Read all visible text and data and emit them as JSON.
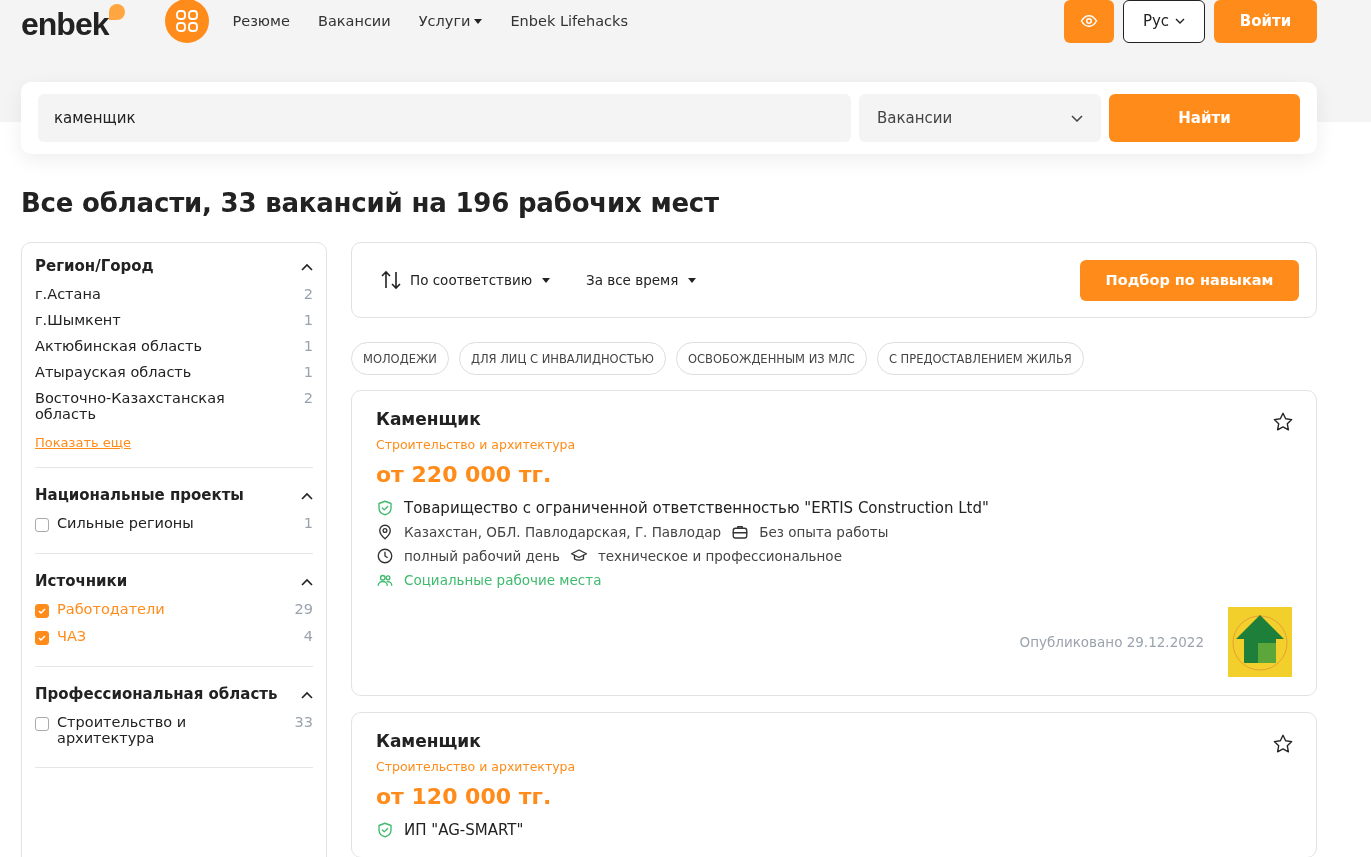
{
  "header": {
    "logo": "enbek",
    "nav": [
      {
        "label": "Резюме",
        "dropdown": false
      },
      {
        "label": "Вакансии",
        "dropdown": false
      },
      {
        "label": "Услуги",
        "dropdown": true
      },
      {
        "label": "Enbek Lifehacks",
        "dropdown": false
      }
    ],
    "language": "Рус",
    "login": "Войти"
  },
  "search": {
    "value": "каменщик",
    "type": "Вакансии",
    "button": "Найти"
  },
  "heading": "Все области, 33 вакансий на 196 рабочих мест",
  "filters": [
    {
      "title": "Регион/Город",
      "expanded": true,
      "items": [
        {
          "kind": "plain",
          "label": "г.Астана",
          "count": "2"
        },
        {
          "kind": "plain",
          "label": "г.Шымкент",
          "count": "1"
        },
        {
          "kind": "plain",
          "label": "Актюбинская область",
          "count": "1"
        },
        {
          "kind": "plain",
          "label": "Атырауская область",
          "count": "1"
        },
        {
          "kind": "plain",
          "label": "Восточно-Казахстанская область",
          "count": "2"
        }
      ],
      "more": "Показать еще"
    },
    {
      "title": "Национальные проекты",
      "expanded": true,
      "items": [
        {
          "kind": "checkbox",
          "label": "Сильные регионы",
          "count": "1",
          "checked": false
        }
      ]
    },
    {
      "title": "Источники",
      "expanded": true,
      "items": [
        {
          "kind": "checkbox",
          "label": "Работодатели",
          "count": "29",
          "checked": true
        },
        {
          "kind": "checkbox",
          "label": "ЧАЗ",
          "count": "4",
          "checked": true
        }
      ]
    },
    {
      "title": "Профессиональная область",
      "expanded": true,
      "items": [
        {
          "kind": "checkbox",
          "label": "Строительство и архитектура",
          "count": "33",
          "checked": false
        }
      ]
    }
  ],
  "toolbar": {
    "sort": "По соответствию",
    "period": "За все время",
    "skills_button": "Подбор по навыкам"
  },
  "tags": [
    "МОЛОДЕЖИ",
    "ДЛЯ ЛИЦ С ИНВАЛИДНОСТЬЮ",
    "ОСВОБОЖДЕННЫМ ИЗ МЛС",
    "С ПРЕДОСТАВЛЕНИЕМ ЖИЛЬЯ"
  ],
  "vacancies": [
    {
      "title": "Каменщик",
      "category": "Строительство и архитектура",
      "salary": "от 220 000 тг.",
      "company": "Товарищество с ограниченной ответственностью \"ERTIS Construction Ltd\"",
      "location": "Казахстан, ОБЛ. Павлодарская, Г. Павлодар",
      "experience": "Без опыта работы",
      "schedule": "полный рабочий день",
      "education": "техническое и профессиональное",
      "social": "Социальные рабочие места",
      "published": "Опубликовано 29.12.2022",
      "has_logo": true
    },
    {
      "title": "Каменщик",
      "category": "Строительство и архитектура",
      "salary": "от 120 000 тг.",
      "company": "ИП \"AG-SMART\""
    }
  ]
}
